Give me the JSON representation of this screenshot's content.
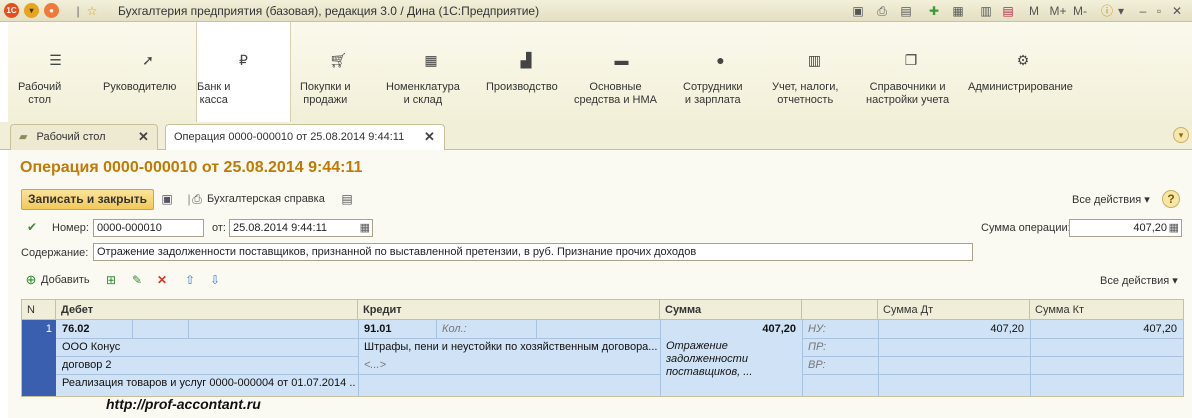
{
  "window": {
    "title": "Бухгалтерия предприятия (базовая), редакция 3.0 / Дина  (1С:Предприятие)",
    "m_label": "M",
    "mplus_label": "M+",
    "mminus_label": "M-"
  },
  "sections": [
    {
      "label": "Рабочий\nстол",
      "icon": "list-icon"
    },
    {
      "label": "Руководителю",
      "icon": "trend-icon"
    },
    {
      "label": "Банк и\nкасса",
      "icon": "ruble-icon"
    },
    {
      "label": "Покупки и\nпродажи",
      "icon": "cart-icon"
    },
    {
      "label": "Номенклатура\nи склад",
      "icon": "grid-icon"
    },
    {
      "label": "Производство",
      "icon": "factory-icon"
    },
    {
      "label": "Основные\nсредства и НМА",
      "icon": "truck-icon"
    },
    {
      "label": "Сотрудники\nи зарплата",
      "icon": "person-icon"
    },
    {
      "label": "Учет, налоги,\nотчетность",
      "icon": "chart-icon"
    },
    {
      "label": "Справочники и\nнастройки учета",
      "icon": "docs-icon"
    },
    {
      "label": "Администрирование",
      "icon": "gear-icon"
    }
  ],
  "tabs": [
    {
      "label": "Рабочий стол"
    },
    {
      "label": "Операция 0000-000010 от 25.08.2014 9:44:11"
    }
  ],
  "form": {
    "title": "Операция 0000-000010 от 25.08.2014 9:44:11",
    "save_close": "Записать и закрыть",
    "report": "Бухгалтерская справка",
    "all_actions": "Все действия ▾",
    "number_label": "Номер:",
    "number": "0000-000010",
    "date_label": "от:",
    "date": "25.08.2014  9:44:11",
    "sum_label": "Сумма операции:",
    "sum": "407,20",
    "content_label": "Содержание:",
    "content": "Отражение задолженности поставщиков, признанной по выставленной претензии, в руб. Признание прочих доходов",
    "add": "Добавить",
    "all_actions2": "Все действия ▾"
  },
  "table": {
    "headers": {
      "n": "N",
      "debet": "Дебет",
      "kredit": "Кредит",
      "summa": "Сумма",
      "sum_dt": "Сумма Дт",
      "sum_kt": "Сумма Кт"
    },
    "row": {
      "n": "1",
      "debet_account": "76.02",
      "debet_sub1": "ООО Конус",
      "debet_sub2": "договор 2",
      "debet_sub3": "Реализация товаров и услуг 0000-000004 от 01.07.2014 ...",
      "kredit_account": "91.01",
      "kol": "Кол.:",
      "kredit_sub1": "Штрафы, пени и неустойки по хозяйственным договора...",
      "kredit_sub2": "<...>",
      "summa": "407,20",
      "summa_note": "Отражение задолженности поставщиков, ...",
      "nu": "НУ:",
      "pr": "ПР:",
      "vr": "ВР:",
      "sum_dt": "407,20",
      "sum_kt": "407,20"
    }
  },
  "watermark": "http://prof-accontant.ru"
}
